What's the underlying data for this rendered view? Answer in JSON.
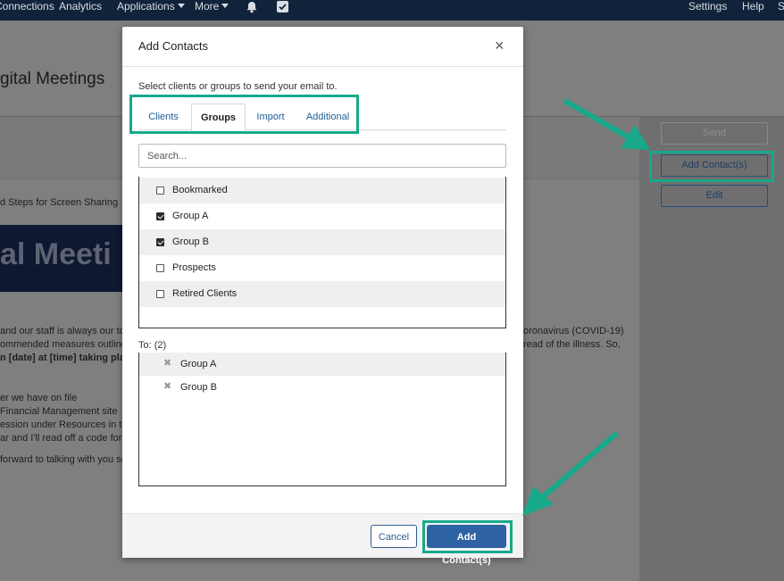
{
  "nav": {
    "items": [
      "Connections",
      "Analytics",
      "Applications",
      "More",
      "Settings",
      "Help",
      "S"
    ],
    "icons": [
      "bell-icon",
      "checkbox-icon"
    ],
    "background": "#10233a"
  },
  "page": {
    "title_fragment": "gital Meetings",
    "subtitle_fragment": "d Steps for Screen Sharing",
    "banner_fragment": "al Meeti",
    "body_lines": [
      "and our staff is always our to",
      "ommended measures outlined",
      "n [date] at [time] taking place",
      "er we have on file",
      "Financial Management site",
      "ession under Resources in the",
      "ar and I'll read off a code for y",
      "forward to talking with you so"
    ],
    "right_fragments": [
      "oronavirus (COVID-19)",
      "read of the illness. So,"
    ],
    "actions": {
      "send": "Send",
      "add_contacts": "Add Contact(s)",
      "edit": "Edit"
    }
  },
  "modal": {
    "title": "Add Contacts",
    "close_glyph": "×",
    "instructions": "Select clients or groups to send your email to.",
    "tabs": [
      "Clients",
      "Groups",
      "Import",
      "Additional"
    ],
    "active_tab": "Groups",
    "search_placeholder": "Search...",
    "groups": [
      {
        "label": "Bookmarked",
        "checked": false
      },
      {
        "label": "Group A",
        "checked": true
      },
      {
        "label": "Group B",
        "checked": true
      },
      {
        "label": "Prospects",
        "checked": false
      },
      {
        "label": "Retired Clients",
        "checked": false
      }
    ],
    "to_label": "To: (2)",
    "recipients": [
      "Group A",
      "Group B"
    ],
    "remove_glyph": "✖",
    "cancel_label": "Cancel",
    "submit_label": "Add Contact(s)"
  },
  "colors": {
    "highlight": "#17a98a",
    "primary_button": "#2d63a3",
    "link": "#1f5c93"
  }
}
